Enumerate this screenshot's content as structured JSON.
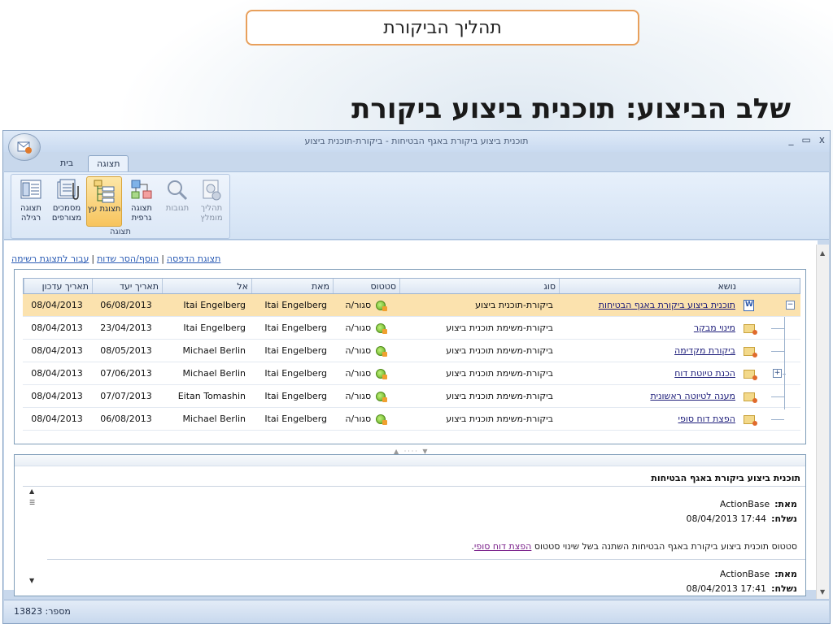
{
  "slide": {
    "title_box": "תהליך הביקורת",
    "heading": "שלב הביצוע: תוכנית ביצוע ביקורת"
  },
  "window": {
    "title": "תוכנית ביצוע ביקורת באגף הבטיחות - ביקורת-תוכנית ביצוע",
    "controls": {
      "close": "x",
      "maximize": "▭",
      "minimize": "_"
    }
  },
  "tabs": [
    {
      "label": "בית",
      "active": false
    },
    {
      "label": "תצוגה",
      "active": true
    }
  ],
  "ribbon": {
    "group_label": "תצוגה",
    "buttons": [
      {
        "label": "תצוגה רגילה",
        "icon": "normal-view-icon",
        "state": "normal"
      },
      {
        "label": "מסמכים מצורפים",
        "icon": "attachments-icon",
        "state": "normal"
      },
      {
        "label": "תצוגת עץ",
        "icon": "tree-view-icon",
        "state": "selected"
      },
      {
        "label": "תצוגה גרפית",
        "icon": "graphic-view-icon",
        "state": "normal"
      },
      {
        "label": "תגובות",
        "icon": "comments-icon",
        "state": "disabled"
      },
      {
        "label": "תהליך מומלץ",
        "icon": "recommended-process-icon",
        "state": "disabled"
      }
    ]
  },
  "links": {
    "switch_list": "עבור לתצוגת רשימה",
    "add_remove_fields": "הוסף/הסר שדות",
    "print_view": "תצוגת הדפסה"
  },
  "grid": {
    "columns": {
      "subject": "נושא",
      "type": "סוג",
      "status": "סטטוס",
      "from": "מאת",
      "to": "אל",
      "due": "תאריך יעד",
      "updated": "תאריך עדכון"
    },
    "rows": [
      {
        "subject": "תוכנית ביצוע ביקורת באגף הבטיחות",
        "type": "ביקורת-תוכנית ביצוע",
        "status": "סגור/ה",
        "from": "Itai Engelberg",
        "to": "Itai Engelberg",
        "due": "06/08/2013",
        "updated": "08/04/2013"
      },
      {
        "subject": "מינוי מבקר",
        "type": "ביקורת-משימת תוכנית ביצוע",
        "status": "סגור/ה",
        "from": "Itai Engelberg",
        "to": "Itai Engelberg",
        "due": "23/04/2013",
        "updated": "08/04/2013"
      },
      {
        "subject": "ביקורת מקדימה",
        "type": "ביקורת-משימת תוכנית ביצוע",
        "status": "סגור/ה",
        "from": "Itai Engelberg",
        "to": "Michael Berlin",
        "due": "08/05/2013",
        "updated": "08/04/2013"
      },
      {
        "subject": "הכנת טיוטת דוח",
        "type": "ביקורת-משימת תוכנית ביצוע",
        "status": "סגור/ה",
        "from": "Itai Engelberg",
        "to": "Michael Berlin",
        "due": "07/06/2013",
        "updated": "08/04/2013"
      },
      {
        "subject": "מענה לטיוטה ראשונית",
        "type": "ביקורת-משימת תוכנית ביצוע",
        "status": "סגור/ה",
        "from": "Itai Engelberg",
        "to": "Eitan Tomashin",
        "due": "07/07/2013",
        "updated": "08/04/2013"
      },
      {
        "subject": "הפצת דוח סופי",
        "type": "ביקורת-משימת תוכנית ביצוע",
        "status": "סגור/ה",
        "from": "Itai Engelberg",
        "to": "Michael Berlin",
        "due": "06/08/2013",
        "updated": "08/04/2013"
      }
    ]
  },
  "preview": {
    "subject": "תוכנית ביצוע ביקורת באגף הבטיחות",
    "from_label": "מאת:",
    "from_value": "ActionBase",
    "sent_label": "נשלח:",
    "sent_value": "17:44 08/04/2013",
    "body_text": "סטטוס תוכנית ביצוע ביקורת באגף הבטיחות השתנה בשל שינוי סטטוס",
    "body_link": "הפצת דוח סופי",
    "body_end": ".",
    "from2_value": "ActionBase",
    "sent2_partial": "17:41 08/04/2013"
  },
  "statusbar": {
    "record_label": "מספר:",
    "record_value": "13823"
  },
  "colors": {
    "selected_row": "#fbe2ae",
    "ribbon_selected": "#f7c45d",
    "link": "#2a5bb4",
    "title_box_border": "#e8a05c"
  }
}
